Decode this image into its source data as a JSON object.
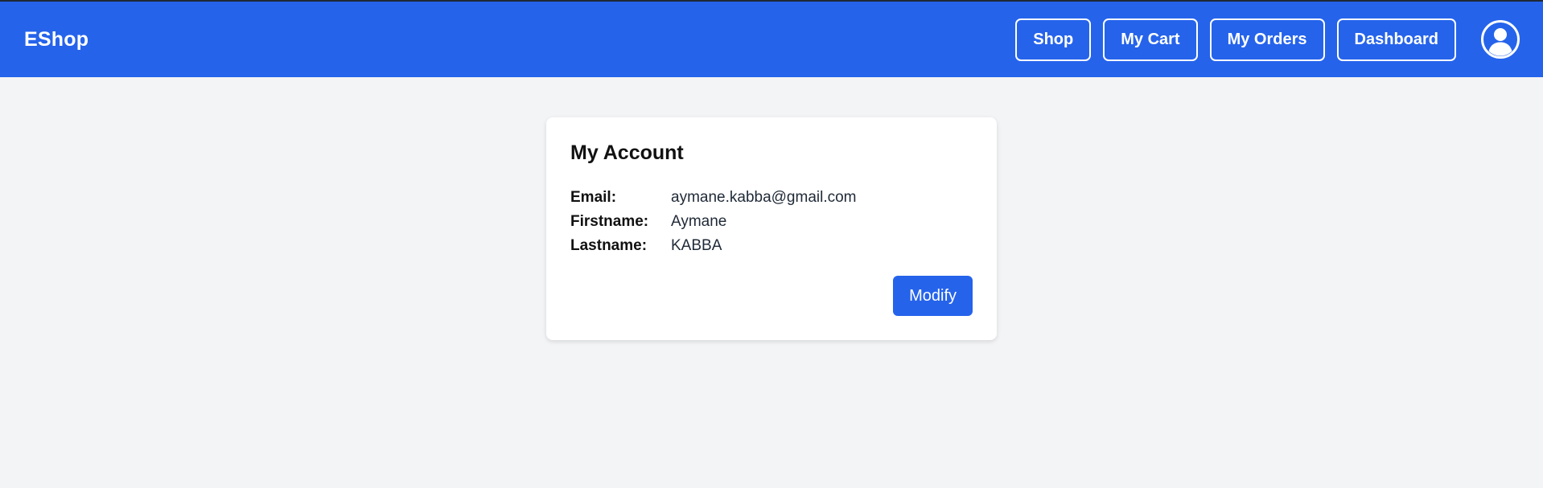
{
  "app": {
    "brand": "EShop"
  },
  "nav": {
    "items": [
      {
        "label": "Shop"
      },
      {
        "label": "My Cart"
      },
      {
        "label": "My Orders"
      },
      {
        "label": "Dashboard"
      }
    ],
    "avatar_icon": "user-circle-icon"
  },
  "account": {
    "title": "My Account",
    "fields": [
      {
        "label": "Email:",
        "value": "aymane.kabba@gmail.com"
      },
      {
        "label": "Firstname:",
        "value": "Aymane"
      },
      {
        "label": "Lastname:",
        "value": "KABBA"
      }
    ],
    "modify_label": "Modify"
  },
  "colors": {
    "primary": "#2563eb",
    "background": "#f3f4f6",
    "card": "#ffffff"
  }
}
